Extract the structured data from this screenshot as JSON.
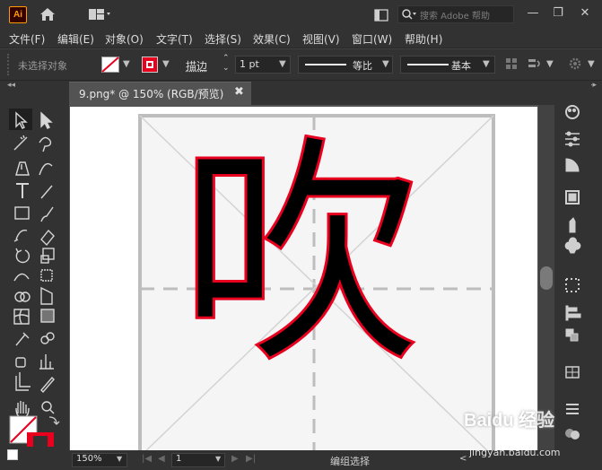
{
  "app": {
    "logo": "Ai"
  },
  "search": {
    "placeholder": "搜索 Adobe 帮助"
  },
  "window": {
    "minimize": "—",
    "restore": "❐",
    "close": "✕"
  },
  "menu": [
    "文件(F)",
    "编辑(E)",
    "对象(O)",
    "文字(T)",
    "选择(S)",
    "效果(C)",
    "视图(V)",
    "窗口(W)",
    "帮助(H)"
  ],
  "control": {
    "selection_status": "未选择对象",
    "stroke_label": "描边",
    "stroke_weight": "1 pt",
    "profile_label": "等比",
    "brush_label": "基本"
  },
  "document": {
    "tab_label": "9.png* @ 150% (RGB/预览)",
    "close": "✖"
  },
  "status": {
    "zoom": "150%",
    "artboard": "1",
    "mode": "编组选择"
  },
  "artwork": {
    "character": "吹"
  },
  "watermark": {
    "text": "Baidu 经验",
    "sub": "jingyan.baidu.com"
  },
  "colors": {
    "fill": "#ffffff",
    "stroke": "#e8001e",
    "accent": "#ff9a00",
    "char_outline": "#e8001e"
  },
  "icons": {
    "tools": [
      "selection-icon",
      "direct-selection-icon",
      "magic-wand-icon",
      "lasso-icon",
      "pen-icon",
      "curvature-icon",
      "type-icon",
      "line-icon",
      "rectangle-icon",
      "paintbrush-icon",
      "blob-brush-icon",
      "eraser-icon",
      "rotate-icon",
      "scale-icon",
      "warp-icon",
      "free-transform-icon",
      "shape-builder-icon",
      "perspective-icon",
      "mesh-icon",
      "gradient-icon",
      "eyedropper-icon",
      "blend-icon",
      "symbol-sprayer-icon",
      "graph-icon",
      "artboard-icon",
      "slice-icon",
      "hand-icon",
      "zoom-icon"
    ],
    "panels": [
      "color-icon",
      "properties-icon",
      "color-guide-icon",
      "libraries-icon",
      "brushes-icon",
      "symbols-icon",
      "align-icon",
      "pathfinder-icon",
      "transform-icon",
      "layers-icon",
      "menu-icon"
    ]
  }
}
